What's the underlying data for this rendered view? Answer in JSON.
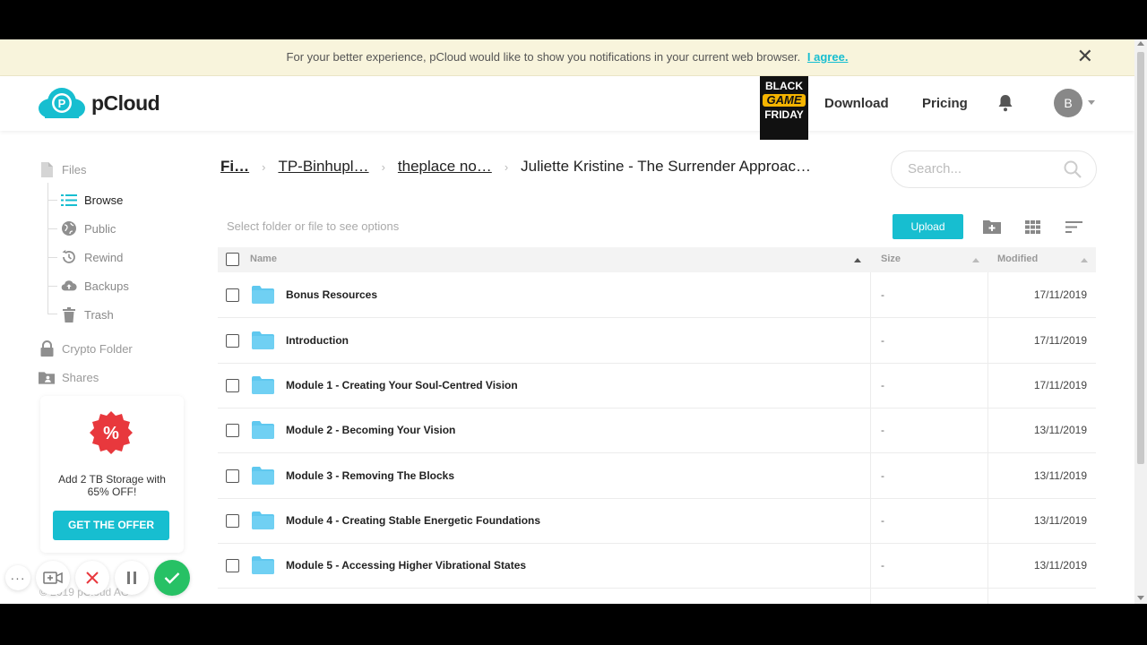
{
  "notification": {
    "message": "For your better experience, pCloud would like to show you notifications in your current web browser.",
    "agree_link": "I agree."
  },
  "header": {
    "logo_text": "pCloud",
    "promo_badge": [
      "BLACK",
      "GAME",
      "FRIDAY"
    ],
    "download": "Download",
    "pricing": "Pricing",
    "avatar_initial": "B"
  },
  "sidebar": {
    "files": "Files",
    "sub_items": [
      {
        "label": "Browse",
        "icon": "list-icon"
      },
      {
        "label": "Public",
        "icon": "globe-icon"
      },
      {
        "label": "Rewind",
        "icon": "history-icon"
      },
      {
        "label": "Backups",
        "icon": "cloud-upload-icon"
      },
      {
        "label": "Trash",
        "icon": "trash-icon"
      }
    ],
    "crypto": "Crypto Folder",
    "shares": "Shares",
    "promo": {
      "badge": "%",
      "text": "Add 2 TB Storage with 65% OFF!",
      "button": "GET THE OFFER"
    },
    "footer": "© 2019 pCloud AG"
  },
  "breadcrumb": {
    "items": [
      "Fi…",
      "TP-Binhupl…",
      "theplace no…"
    ],
    "current": "Juliette Kristine - The Surrender Approac…"
  },
  "search": {
    "placeholder": "Search..."
  },
  "toolbar": {
    "hint": "Select folder or file to see options",
    "upload": "Upload"
  },
  "table": {
    "columns": {
      "name": "Name",
      "size": "Size",
      "modified": "Modified"
    },
    "rows": [
      {
        "name": "Bonus Resources",
        "size": "-",
        "modified": "17/11/2019"
      },
      {
        "name": "Introduction",
        "size": "-",
        "modified": "17/11/2019"
      },
      {
        "name": "Module 1 - Creating Your Soul-Centred Vision",
        "size": "-",
        "modified": "17/11/2019"
      },
      {
        "name": "Module 2 - Becoming Your Vision",
        "size": "-",
        "modified": "13/11/2019"
      },
      {
        "name": "Module 3 - Removing The Blocks",
        "size": "-",
        "modified": "13/11/2019"
      },
      {
        "name": "Module 4 - Creating Stable Energetic Foundations",
        "size": "-",
        "modified": "13/11/2019"
      },
      {
        "name": "Module 5 - Accessing Higher Vibrational States",
        "size": "-",
        "modified": "13/11/2019"
      }
    ]
  },
  "colors": {
    "accent": "#17bed0",
    "folder": "#5fc8ef",
    "promo_red": "#e8383d",
    "confirm_green": "#27c165"
  }
}
